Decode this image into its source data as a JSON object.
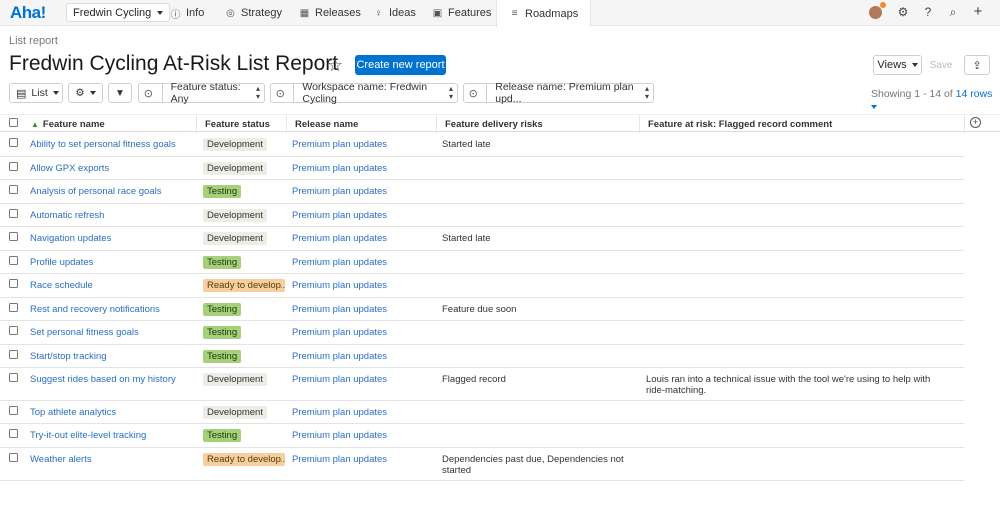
{
  "nav": {
    "logo": "Aha!",
    "workspace": "Fredwin Cycling",
    "tabs": [
      "Info",
      "Strategy",
      "Releases",
      "Ideas",
      "Features",
      "Roadmaps"
    ],
    "active_tab": "Roadmaps"
  },
  "header": {
    "breadcrumb": "List report",
    "title": "Fredwin Cycling At-Risk List Report",
    "create_label": "Create new report",
    "views_label": "Views",
    "save_label": "Save"
  },
  "filters": {
    "view_type": "List",
    "feature_status": "Feature status: Any",
    "workspace_name": "Workspace name: Fredwin Cycling",
    "release_name": "Release name: Premium plan upd..."
  },
  "showing": {
    "prefix": "Showing 1 - 14 of",
    "link": "14 rows"
  },
  "columns": [
    "Feature name",
    "Feature status",
    "Release name",
    "Feature delivery risks",
    "Feature at risk: Flagged record comment"
  ],
  "rows": [
    {
      "name": "Ability to set personal fitness goals",
      "status": "Development",
      "release": "Premium plan updates",
      "risk": "Started late",
      "comment": ""
    },
    {
      "name": "Allow GPX exports",
      "status": "Development",
      "release": "Premium plan updates",
      "risk": "",
      "comment": ""
    },
    {
      "name": "Analysis of personal race goals",
      "status": "Testing",
      "release": "Premium plan updates",
      "risk": "",
      "comment": ""
    },
    {
      "name": "Automatic refresh",
      "status": "Development",
      "release": "Premium plan updates",
      "risk": "",
      "comment": ""
    },
    {
      "name": "Navigation updates",
      "status": "Development",
      "release": "Premium plan updates",
      "risk": "Started late",
      "comment": ""
    },
    {
      "name": "Profile updates",
      "status": "Testing",
      "release": "Premium plan updates",
      "risk": "",
      "comment": ""
    },
    {
      "name": "Race schedule",
      "status": "Ready to develop",
      "release": "Premium plan updates",
      "risk": "",
      "comment": ""
    },
    {
      "name": "Rest and recovery notifications",
      "status": "Testing",
      "release": "Premium plan updates",
      "risk": "Feature due soon",
      "comment": ""
    },
    {
      "name": "Set personal fitness goals",
      "status": "Testing",
      "release": "Premium plan updates",
      "risk": "",
      "comment": ""
    },
    {
      "name": "Start/stop tracking",
      "status": "Testing",
      "release": "Premium plan updates",
      "risk": "",
      "comment": ""
    },
    {
      "name": "Suggest rides based on my history",
      "status": "Development",
      "release": "Premium plan updates",
      "risk": "Flagged record",
      "comment": "Louis ran into a technical issue with the tool we're using to help with ride-matching."
    },
    {
      "name": "Top athlete analytics",
      "status": "Development",
      "release": "Premium plan updates",
      "risk": "",
      "comment": ""
    },
    {
      "name": "Try-it-out elite-level tracking",
      "status": "Testing",
      "release": "Premium plan updates",
      "risk": "",
      "comment": ""
    },
    {
      "name": "Weather alerts",
      "status": "Ready to develop",
      "release": "Premium plan updates",
      "risk": "Dependencies past due, Dependencies not started",
      "comment": ""
    }
  ],
  "colors": {
    "accent": "#0073cf",
    "development": "#eaeee4",
    "testing": "#a6d07a",
    "ready": "#f6cf9f"
  }
}
